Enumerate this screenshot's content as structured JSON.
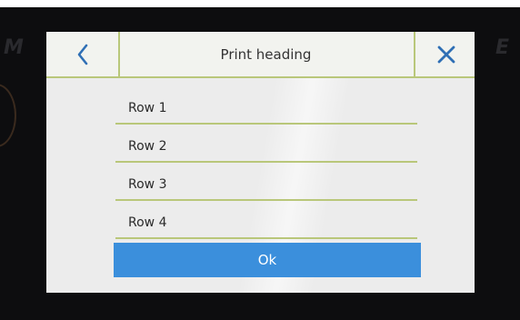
{
  "background": {
    "left_glyph": "M",
    "right_glyph": "E"
  },
  "dialog": {
    "title": "Print heading",
    "back_icon": "chevron-left-icon",
    "close_icon": "close-icon",
    "rows": [
      {
        "label": "Row 1"
      },
      {
        "label": "Row 2"
      },
      {
        "label": "Row 3"
      },
      {
        "label": "Row 4"
      }
    ],
    "ok_label": "Ok"
  },
  "colors": {
    "accent_line": "#b9c77a",
    "icon_blue": "#2f6fb5",
    "ok_button": "#3b8fdc"
  }
}
